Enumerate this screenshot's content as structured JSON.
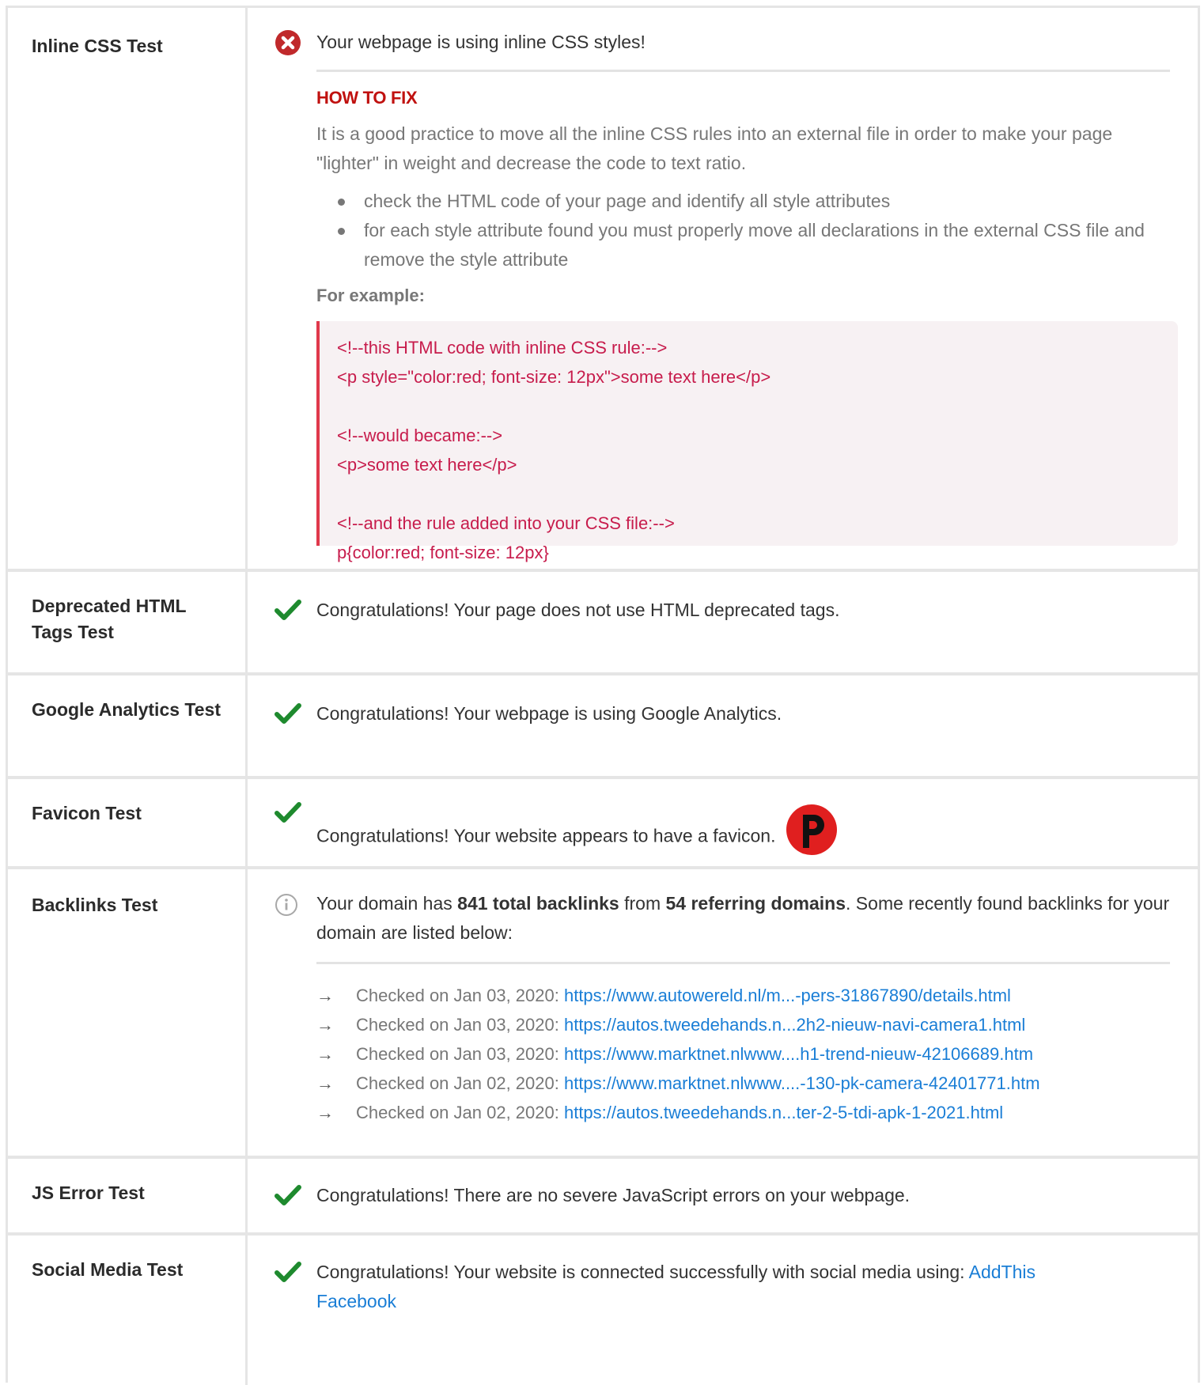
{
  "rows": {
    "inline_css": {
      "label": "Inline CSS Test",
      "message": "Your webpage is using inline CSS styles!",
      "how_to_fix_heading": "HOW TO FIX",
      "fix_text": "It is a good practice to move all the inline CSS rules into an external file in order to make your page \"lighter\" in weight and decrease the code to text ratio.",
      "bullets": [
        "check the HTML code of your page and identify all style attributes",
        "for each style attribute found you must properly move all declarations in the external CSS file and remove the style attribute"
      ],
      "example_label": "For example:",
      "code_lines": [
        "<!--this HTML code with inline CSS rule:-->",
        "<p style=\"color:red; font-size: 12px\">some text here</p>",
        "",
        "<!--would became:-->",
        "<p>some text here</p>",
        "",
        "<!--and the rule added into your CSS file:-->",
        "p{color:red; font-size: 12px}"
      ],
      "status": "fail"
    },
    "deprecated_html": {
      "label": "Deprecated HTML Tags Test",
      "message": "Congratulations! Your page does not use HTML deprecated tags.",
      "status": "pass"
    },
    "google_analytics": {
      "label": "Google Analytics Test",
      "message": "Congratulations! Your webpage is using Google Analytics.",
      "status": "pass"
    },
    "favicon": {
      "label": "Favicon Test",
      "message": "Congratulations! Your website appears to have a favicon.",
      "status": "pass",
      "favicon_letter": "P"
    },
    "backlinks": {
      "label": "Backlinks Test",
      "message_prefix": "Your domain has ",
      "total_backlinks": "841 total backlinks",
      "message_mid": " from ",
      "referring_domains": "54 referring domains",
      "message_suffix": ". Some recently found backlinks for your domain are listed below:",
      "status": "info",
      "items": [
        {
          "date": "Checked on Jan 03, 2020: ",
          "url": "https://www.autowereld.nl/m...-pers-31867890/details.html"
        },
        {
          "date": "Checked on Jan 03, 2020: ",
          "url": "https://autos.tweedehands.n...2h2-nieuw-navi-camera1.html"
        },
        {
          "date": "Checked on Jan 03, 2020: ",
          "url": "https://www.marktnet.nlwww....h1-trend-nieuw-42106689.htm"
        },
        {
          "date": "Checked on Jan 02, 2020: ",
          "url": "https://www.marktnet.nlwww....-130-pk-camera-42401771.htm"
        },
        {
          "date": "Checked on Jan 02, 2020: ",
          "url": "https://autos.tweedehands.n...ter-2-5-tdi-apk-1-2021.html"
        }
      ]
    },
    "js_error": {
      "label": "JS Error Test",
      "message": "Congratulations! There are no severe JavaScript errors on your webpage.",
      "status": "pass"
    },
    "social_media": {
      "label": "Social Media Test",
      "message": "Congratulations! Your website is connected successfully with social media using: ",
      "links": [
        "AddThis",
        "Facebook"
      ],
      "status": "pass"
    }
  },
  "colors": {
    "pass": "#1e8a2e",
    "fail": "#c0292b",
    "info": "#9a9a9a",
    "link": "#1a7ed6",
    "code": "#c71c4c"
  },
  "icons": {
    "pass": "checkmark-icon",
    "fail": "error-circle-icon",
    "info": "info-circle-icon",
    "bullet_arrow": "arrow-right-icon"
  }
}
